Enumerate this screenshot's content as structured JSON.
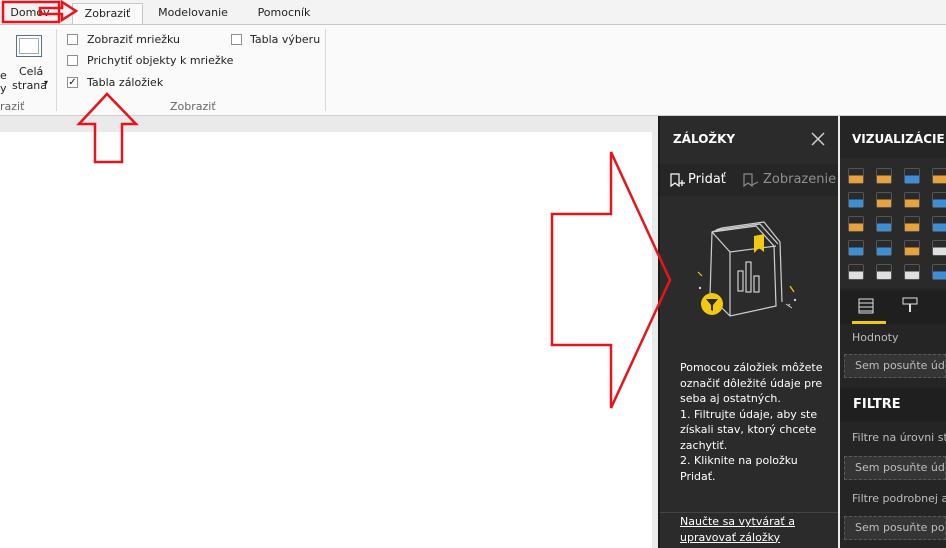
{
  "tabs": [
    {
      "label": "Domov"
    },
    {
      "label": "Zobraziť"
    },
    {
      "label": "Modelovanie"
    },
    {
      "label": "Pomocník"
    }
  ],
  "ribbon": {
    "left_group_partial_label": "raziť",
    "page_view_partial": [
      "e",
      "y"
    ],
    "whole_page": {
      "line1": "Celá",
      "line2": "strana"
    },
    "checkboxes": [
      {
        "label": "Zobraziť mriežku",
        "checked": false
      },
      {
        "label": "Prichytiť objekty k mriežke",
        "checked": false
      },
      {
        "label": "Tabla záložiek",
        "checked": true
      },
      {
        "label": "Tabla výberu",
        "checked": false
      }
    ],
    "group_label": "Zobraziť"
  },
  "bookmarks": {
    "title": "ZÁLOŽKY",
    "add_label": "Pridať",
    "view_label": "Zobrazenie",
    "description_lines": [
      "Pomocou záložiek môžete",
      "označiť dôležité údaje pre",
      "seba aj ostatných.",
      "1. Filtrujte údaje, aby ste",
      "získali stav, ktorý chcete",
      "zachytiť.",
      "2. Kliknite na položku",
      "Pridať."
    ],
    "link_line1": "Naučte sa vytvárať a",
    "link_line2": "upravovať záložky"
  },
  "visualizations": {
    "title": "VIZUALIZÁCIE",
    "values_label": "Hodnoty",
    "values_drop": "Sem posuňte údaje",
    "filters_title": "FILTRE",
    "page_filter_label": "Filtre na úrovni strany",
    "page_filter_drop": "Sem posuňte údaje",
    "drill_filter_label": "Filtre podrobnej analýzy",
    "drill_filter_drop": "Sem posuňte polia"
  },
  "colors": {
    "annotation_red": "#e8141b",
    "bookmark_accent": "#f2c811",
    "pane_bg": "#2b2b2b",
    "viz_bg": "#252525",
    "tab_red_box": "#e8141b"
  }
}
